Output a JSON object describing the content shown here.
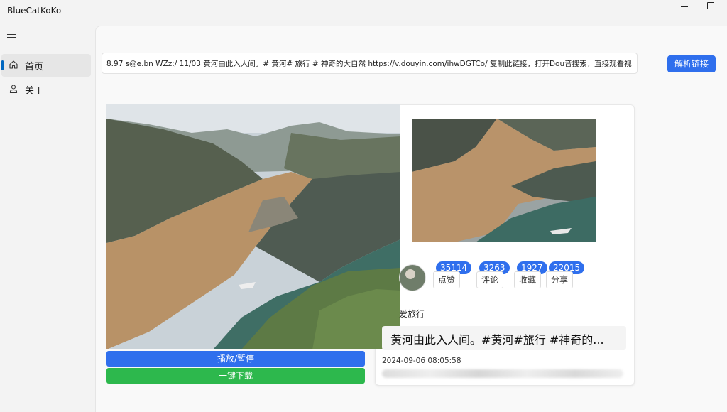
{
  "app": {
    "title": "BlueCatKoKo"
  },
  "sidebar": {
    "items": [
      {
        "label": "首页",
        "icon": "home-icon",
        "selected": true
      },
      {
        "label": "关于",
        "icon": "user-icon",
        "selected": false
      }
    ]
  },
  "search": {
    "value": "8.97 s@e.bn WZz:/ 11/03 黄河由此入人间。# 黄河# 旅行 # 神奇的大自然  https://v.douyin.com/ihwDGTCo/ 复制此链接，打开Dou音搜索，直接观看视频！",
    "button_label": "解析链接"
  },
  "video": {
    "author": "爱旅行",
    "description": "黄河由此入人间。#黄河#旅行 #神奇的...",
    "publish_time": "2024-09-06 08:05:58",
    "stats": [
      {
        "label": "点赞",
        "value": "35114"
      },
      {
        "label": "评论",
        "value": "3263"
      },
      {
        "label": "收藏",
        "value": "1927"
      },
      {
        "label": "分享",
        "value": "22015"
      }
    ]
  },
  "actions": {
    "play_label": "播放/暂停",
    "download_label": "一键下载"
  },
  "colors": {
    "accent": "#2f6fed",
    "download": "#2db84d"
  }
}
